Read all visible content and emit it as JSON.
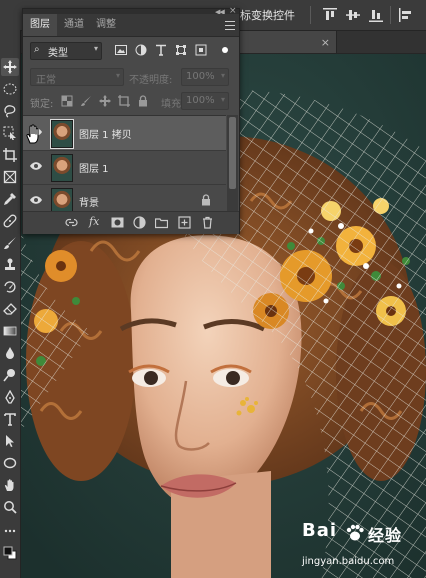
{
  "option_bar": {
    "transform_label": "标变换控件"
  },
  "document": {
    "tab_close": "×"
  },
  "layers_panel": {
    "tabs": [
      {
        "label": "图层",
        "active": true
      },
      {
        "label": "通道",
        "active": false
      },
      {
        "label": "调整",
        "active": false
      }
    ],
    "filter": {
      "kind_label": "类型",
      "icons": [
        "image-filter-icon",
        "adjustment-filter-icon",
        "text-filter-icon",
        "shape-filter-icon",
        "smart-object-filter-icon"
      ]
    },
    "blend_mode": "正常",
    "opacity_label": "不透明度:",
    "opacity_value": "100%",
    "lock_label": "锁定:",
    "fill_label": "填充:",
    "fill_value": "100%",
    "layers": [
      {
        "name": "图层 1 拷贝",
        "visible": true,
        "selected": true,
        "locked": false
      },
      {
        "name": "图层 1",
        "visible": true,
        "selected": false,
        "locked": false
      },
      {
        "name": "背景",
        "visible": true,
        "selected": false,
        "locked": true
      }
    ],
    "bottom_fx": "fx"
  },
  "watermark": {
    "brand": "Bai",
    "brand_suffix": "经验",
    "site": "jingyan.baidu.com"
  },
  "colors": {
    "panel_bg": "#494949",
    "selected_row": "#5d5d5d",
    "canvas_bg": "#233936",
    "ui_bar": "#3b3b3b"
  }
}
